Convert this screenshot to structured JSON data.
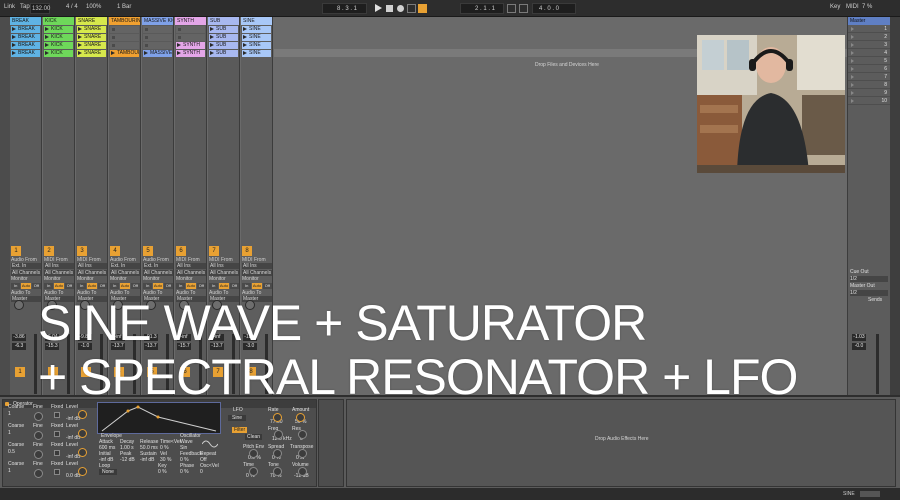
{
  "transport": {
    "link": "Link",
    "tap": "Tap",
    "tempo": "132.00",
    "signature": "4 / 4",
    "zoom": "100%",
    "quantize": "1 Bar",
    "arrangement_pos": "8 . 3 . 1",
    "loop_start": "2 . 1 . 1",
    "loop_length": "4 . 0 . 0",
    "key": "Key",
    "midi": "MIDI",
    "cpu": "7 %",
    "accent": "#e8a133"
  },
  "tracks": [
    {
      "name": "BREAK",
      "color": "#5fb3e4",
      "clips": [
        "BREAK",
        "BREAK",
        "BREAK",
        "BREAK"
      ],
      "audio_from": "Audio From",
      "from_value": "Ext. In",
      "to_value": "Master",
      "num": "1",
      "vol": "-3.86",
      "vol2": "-6.3"
    },
    {
      "name": "KICK",
      "color": "#6ed85a",
      "clips": [
        "KICK",
        "KICK",
        "KICK",
        "KICK"
      ],
      "audio_from": "MIDI From",
      "from_value": "All Ins",
      "to_value": "Master",
      "num": "2",
      "vol": "-6.04",
      "vol2": "-15.3"
    },
    {
      "name": "SNARE",
      "color": "#d6e84c",
      "clips": [
        "SNARE",
        "SNARE",
        "SNARE",
        "SNARE"
      ],
      "audio_from": "MIDI From",
      "from_value": "All Ins",
      "to_value": "Master",
      "num": "3",
      "vol": "-9.83",
      "vol2": "-1.0"
    },
    {
      "name": "TAMBOURINE",
      "color": "#f0a030",
      "clips": [
        "",
        "",
        "",
        "TAMBOURI"
      ],
      "audio_from": "Audio From",
      "from_value": "Ext. In",
      "to_value": "Master",
      "num": "4",
      "vol": "-inf",
      "vol2": "-13.7"
    },
    {
      "name": "MASSIVE KICK",
      "color": "#7fa1e8",
      "clips": [
        "",
        "",
        "",
        "MASSIVE"
      ],
      "audio_from": "Audio From",
      "from_value": "Ext. In",
      "to_value": "Master",
      "num": "5",
      "vol": "-91.3",
      "vol2": "-13.7"
    },
    {
      "name": "SYNTH",
      "color": "#e4a6e8",
      "clips": [
        "",
        "",
        "SYNTH",
        "SYNTH"
      ],
      "audio_from": "MIDI From",
      "from_value": "All Ins",
      "to_value": "Master",
      "num": "6",
      "vol": "-inf",
      "vol2": "-15.7"
    },
    {
      "name": "SUB",
      "color": "#a8b8f0",
      "clips": [
        "SUB",
        "SUB",
        "SUB",
        "SUB"
      ],
      "audio_from": "MIDI From",
      "from_value": "All Ins",
      "to_value": "Master",
      "num": "7",
      "vol": "-inf",
      "vol2": "-13.7"
    },
    {
      "name": "SINE",
      "color": "#a8c8f8",
      "clips": [
        "SINE",
        "SINE",
        "SINE",
        "SINE"
      ],
      "audio_from": "MIDI From",
      "from_value": "All Ins",
      "to_value": "Master",
      "num": "8",
      "vol": "-13.6",
      "vol2": "-3.0"
    }
  ],
  "session": {
    "drop_hint": "Drop Files and Devices Here",
    "monitor_label": "Monitor",
    "monitor_in": "In",
    "monitor_auto": "Auto",
    "monitor_off": "Off",
    "audio_to": "Audio To",
    "sends": "Sends",
    "all_channels": "All Channels"
  },
  "master": {
    "name": "Master",
    "scenes": [
      "1",
      "2",
      "3",
      "4",
      "5",
      "6",
      "7",
      "8",
      "9",
      "10"
    ],
    "cue_out": "Cue Out",
    "cue_value": "1/2",
    "master_out": "Master Out",
    "master_value": "1/2",
    "sends": "Sends",
    "vol": "-1.03",
    "vol2": "-0.0"
  },
  "caption": {
    "line1": "SINE WAVE + SATURATOR",
    "line2": "+ SPECTRAL RESONATOR + LFO"
  },
  "operator": {
    "title": "Operator",
    "coarse": "Coarse",
    "fine": "Fine",
    "fixed": "Fixed",
    "level": "Level",
    "level_values": [
      "-inf dB",
      "-inf dB",
      "-inf dB",
      "0.0 dB"
    ],
    "coarse_values": [
      "1",
      "1",
      "0.5",
      "1"
    ],
    "fine_values": [
      "0",
      "0",
      "0",
      "0"
    ],
    "envelope_tab": "Envelope",
    "oscillator_tab": "Oscillator",
    "attack": "Attack",
    "attack_v": "600 ms",
    "decay": "Decay",
    "decay_v": "1.00 s",
    "release": "Release",
    "release_v": "50.0 ms",
    "time_vel": "Time<Vel",
    "time_vel_v": "0 %",
    "initial": "Initial",
    "initial_v": "-inf dB",
    "peak": "Peak",
    "peak_v": "-12 dB",
    "sustain": "Sustain",
    "sustain_v": "-inf dB",
    "vel": "Vel",
    "vel_v": "30 %",
    "loop": "Loop",
    "loop_v": "None",
    "key": "Key",
    "key_v": "0 %",
    "wave": "Wave",
    "wave_v": "Sin",
    "feedback": "Feedback",
    "feedback_v": "0 %",
    "repeat": "Repeat",
    "repeat_v": "Off",
    "phase": "Phase",
    "phase_v": "0 %",
    "osc_vel": "Osc<Vel",
    "osc_vel_v": "0"
  },
  "lfo": {
    "title": "LFO",
    "rate": "Rate",
    "rate_v": "77.00",
    "amount": "Amount",
    "amount_v": "50 %",
    "wave": "Sine",
    "filter": "Filter",
    "filter_type": "Clean",
    "freq": "Freq",
    "freq_v": "12.0 kHz",
    "res": "Res",
    "res_v": "0",
    "pitch_env": "Pitch Env",
    "pitch_env_v": "0.0 %",
    "spread": "Spread",
    "spread_v": "0 %",
    "transpose": "Transpose",
    "transpose_v": "0 st",
    "time": "Time",
    "time_v": "0 %",
    "tone": "Tone",
    "tone_v": "70 %",
    "volume": "Volume",
    "volume_v": "-12 dB"
  },
  "effects": {
    "drop_hint": "Drop Audio Effects Here",
    "insert_label": "SINE"
  }
}
